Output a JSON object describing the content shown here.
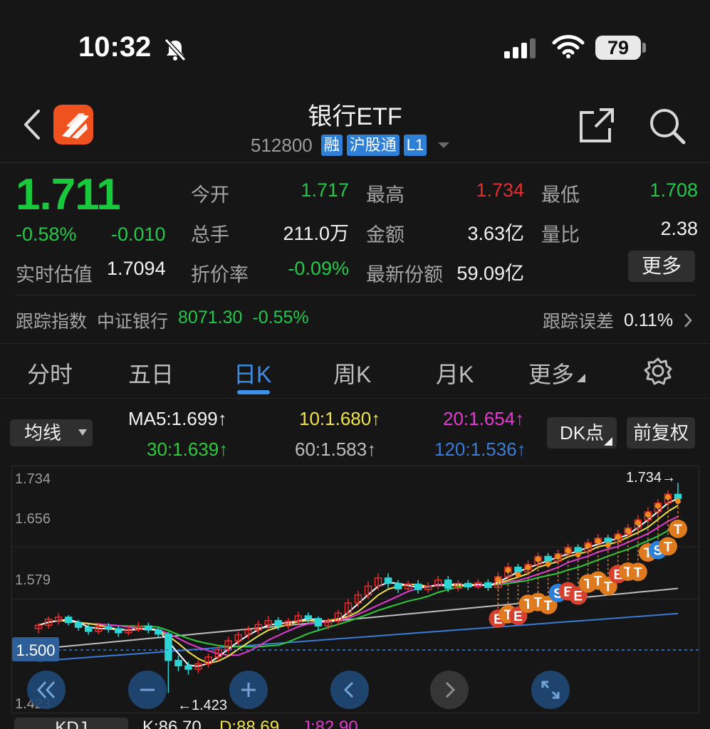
{
  "status": {
    "time": "10:32",
    "battery": "79"
  },
  "header": {
    "title": "银行ETF",
    "code": "512800",
    "tags": [
      "融",
      "沪股通",
      "L1"
    ]
  },
  "quote": {
    "price": "1.711",
    "change_pct": "-0.58%",
    "change": "-0.010",
    "iopv_label": "实时估值",
    "iopv": "1.7094",
    "fields": {
      "open_label": "今开",
      "open": "1.717",
      "high_label": "最高",
      "high": "1.734",
      "low_label": "最低",
      "low": "1.708",
      "volume_label": "总手",
      "volume": "211.0万",
      "amount_label": "金额",
      "amount": "3.63亿",
      "ratio_label": "量比",
      "ratio": "2.38",
      "discount_label": "折价率",
      "discount": "-0.09%",
      "shares_label": "最新份额",
      "shares": "59.09亿"
    },
    "more_label": "更多"
  },
  "tracking": {
    "label": "跟踪指数",
    "index_name": "中证银行",
    "index_value": "8071.30",
    "index_change": "-0.55%",
    "error_label": "跟踪误差",
    "error_value": "0.11%"
  },
  "tabs": [
    "分时",
    "五日",
    "日K",
    "周K",
    "月K",
    "更多"
  ],
  "active_tab": "日K",
  "indicator": {
    "ma_selector": "均线",
    "dk_label": "DK点",
    "adjust_label": "前复权",
    "ma5": "MA5:1.699",
    "ma10": "10:1.680",
    "ma20": "20:1.654",
    "ma30": "30:1.639",
    "ma60": "60:1.583",
    "ma120": "120:1.536",
    "arrow": "↑"
  },
  "colors": {
    "up": "#e62e2e",
    "down": "#2dd4d4",
    "ma5": "#ffffff",
    "ma10": "#f0e34a",
    "ma20": "#e33ad2",
    "ma30": "#2fc93c",
    "ma60": "#bdbdbd",
    "ma120": "#3a7bd5",
    "accent": "#3d8fe8"
  },
  "chart_data": {
    "type": "candlestick",
    "y_ticks": [
      "1.734",
      "1.656",
      "1.579",
      "1.500",
      "1.423"
    ],
    "ylim": [
      1.4,
      1.75
    ],
    "current_label": "1.500",
    "max_annotation": "1.734→",
    "min_annotation": "←1.423",
    "candles": [
      [
        1.518,
        1.523,
        1.511,
        1.526
      ],
      [
        1.523,
        1.532,
        1.518,
        1.536
      ],
      [
        1.53,
        1.535,
        1.524,
        1.541
      ],
      [
        1.535,
        1.527,
        1.523,
        1.538
      ],
      [
        1.527,
        1.52,
        1.515,
        1.531
      ],
      [
        1.52,
        1.514,
        1.509,
        1.524
      ],
      [
        1.514,
        1.521,
        1.51,
        1.527
      ],
      [
        1.521,
        1.518,
        1.512,
        1.526
      ],
      [
        1.518,
        1.512,
        1.506,
        1.522
      ],
      [
        1.512,
        1.517,
        1.508,
        1.523
      ],
      [
        1.517,
        1.522,
        1.513,
        1.528
      ],
      [
        1.522,
        1.516,
        1.511,
        1.527
      ],
      [
        1.516,
        1.51,
        1.505,
        1.52
      ],
      [
        1.51,
        1.471,
        1.423,
        1.513
      ],
      [
        1.471,
        1.463,
        1.455,
        1.478
      ],
      [
        1.463,
        1.458,
        1.45,
        1.469
      ],
      [
        1.458,
        1.466,
        1.452,
        1.471
      ],
      [
        1.466,
        1.476,
        1.46,
        1.481
      ],
      [
        1.476,
        1.487,
        1.47,
        1.492
      ],
      [
        1.487,
        1.5,
        1.482,
        1.506
      ],
      [
        1.5,
        1.509,
        1.494,
        1.514
      ],
      [
        1.509,
        1.516,
        1.503,
        1.522
      ],
      [
        1.516,
        1.524,
        1.51,
        1.53
      ],
      [
        1.524,
        1.53,
        1.518,
        1.537
      ],
      [
        1.53,
        1.522,
        1.516,
        1.535
      ],
      [
        1.522,
        1.529,
        1.517,
        1.534
      ],
      [
        1.529,
        1.537,
        1.523,
        1.543
      ],
      [
        1.537,
        1.533,
        1.527,
        1.542
      ],
      [
        1.533,
        1.522,
        1.515,
        1.536
      ],
      [
        1.522,
        1.529,
        1.517,
        1.534
      ],
      [
        1.529,
        1.541,
        1.524,
        1.546
      ],
      [
        1.541,
        1.556,
        1.535,
        1.562
      ],
      [
        1.556,
        1.568,
        1.55,
        1.574
      ],
      [
        1.568,
        1.581,
        1.562,
        1.588
      ],
      [
        1.581,
        1.593,
        1.575,
        1.6
      ],
      [
        1.593,
        1.585,
        1.578,
        1.6
      ],
      [
        1.585,
        1.577,
        1.571,
        1.59
      ],
      [
        1.577,
        1.584,
        1.572,
        1.589
      ],
      [
        1.584,
        1.576,
        1.57,
        1.59
      ],
      [
        1.576,
        1.581,
        1.571,
        1.587
      ],
      [
        1.581,
        1.59,
        1.576,
        1.596
      ],
      [
        1.59,
        1.578,
        1.572,
        1.596
      ],
      [
        1.578,
        1.585,
        1.573,
        1.59
      ],
      [
        1.585,
        1.58,
        1.575,
        1.59
      ],
      [
        1.58,
        1.586,
        1.576,
        1.591
      ],
      [
        1.586,
        1.579,
        1.574,
        1.591
      ],
      [
        1.579,
        1.595,
        1.575,
        1.602
      ],
      [
        1.595,
        1.609,
        1.59,
        1.616
      ],
      [
        1.609,
        1.602,
        1.596,
        1.614
      ],
      [
        1.602,
        1.613,
        1.597,
        1.619
      ],
      [
        1.613,
        1.625,
        1.608,
        1.631
      ],
      [
        1.625,
        1.618,
        1.612,
        1.63
      ],
      [
        1.618,
        1.629,
        1.613,
        1.635
      ],
      [
        1.629,
        1.638,
        1.624,
        1.644
      ],
      [
        1.638,
        1.632,
        1.626,
        1.643
      ],
      [
        1.632,
        1.645,
        1.627,
        1.651
      ],
      [
        1.645,
        1.652,
        1.64,
        1.658
      ],
      [
        1.652,
        1.646,
        1.64,
        1.657
      ],
      [
        1.646,
        1.658,
        1.641,
        1.664
      ],
      [
        1.658,
        1.667,
        1.653,
        1.673
      ],
      [
        1.667,
        1.679,
        1.661,
        1.686
      ],
      [
        1.679,
        1.691,
        1.673,
        1.698
      ],
      [
        1.691,
        1.704,
        1.685,
        1.71
      ],
      [
        1.704,
        1.717,
        1.699,
        1.723
      ],
      [
        1.717,
        1.711,
        1.708,
        1.734
      ]
    ],
    "signals": [
      "E",
      "T",
      "E",
      "T",
      "T",
      "T",
      "S",
      "E",
      "E",
      "T",
      "T",
      "T",
      "E",
      "T",
      "T",
      "T",
      "S",
      "T",
      "T"
    ]
  },
  "kdj": {
    "label": "KDJ",
    "k": "K:86.70",
    "d": "D:88.69",
    "j": "J:82.90"
  }
}
